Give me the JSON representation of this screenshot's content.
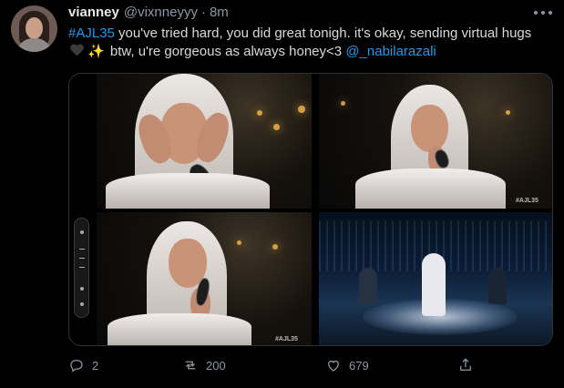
{
  "tweet": {
    "author": {
      "display_name": "vianney",
      "handle": "@vixnneyyy",
      "separator": "·",
      "time": "8m"
    },
    "text": {
      "hashtag": "#AJL35",
      "part1": " you've tried hard, you did great tonigh. it's okay, sending virtual hugs ",
      "part2": " btw, u're gorgeous as always honey<3 ",
      "mention": "@_nabilarazali"
    },
    "media": {
      "images": [
        {
          "description": "performer in white hijab crying with hands on face at microphone"
        },
        {
          "description": "performer in white hijab singing into microphone"
        },
        {
          "description": "performer in white hijab holding microphone"
        },
        {
          "description": "wide stage shot with smoke and blue lighting"
        }
      ],
      "watermark": "#AJL35"
    },
    "actions": {
      "reply_count": "2",
      "retweet_count": "200",
      "like_count": "679"
    }
  },
  "icons": {
    "more": "more-icon",
    "reply": "reply-icon",
    "retweet": "retweet-icon",
    "like": "heart-icon",
    "share": "share-icon",
    "emoji_heart": "black-heart-emoji-icon",
    "emoji_sparkles": "sparkles-emoji-icon"
  },
  "colors": {
    "background": "#000000",
    "text": "#d9d9d9",
    "secondary": "#8b98a5",
    "accent": "#1d9bf0"
  }
}
